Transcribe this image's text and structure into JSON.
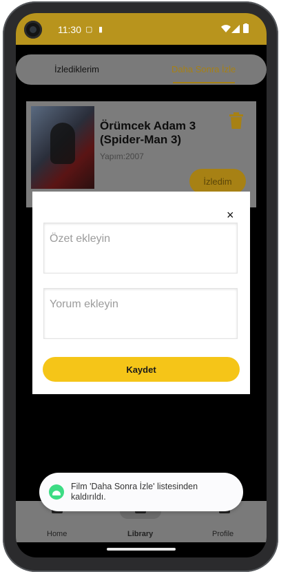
{
  "status_bar": {
    "time": "11:30"
  },
  "tabs": [
    {
      "label": "İzlediklerim",
      "active": false
    },
    {
      "label": "Daha Sonra İzle",
      "active": true
    }
  ],
  "movie": {
    "title": "Örümcek Adam 3 (Spider-Man 3)",
    "year": "Yapım:2007",
    "watched_label": "İzledim"
  },
  "modal": {
    "close_label": "×",
    "summary_placeholder": "Özet ekleyin",
    "comment_placeholder": "Yorum ekleyin",
    "save_label": "Kaydet"
  },
  "bottom_nav": [
    {
      "label": "Home"
    },
    {
      "label": "Library"
    },
    {
      "label": "Profile"
    }
  ],
  "toast": {
    "message": "Film 'Daha Sonra İzle' listesinden kaldırıldı."
  },
  "colors": {
    "accent": "#f5c518",
    "dim_overlay_accent": "#a78114",
    "status_bar": "#b8941d"
  }
}
